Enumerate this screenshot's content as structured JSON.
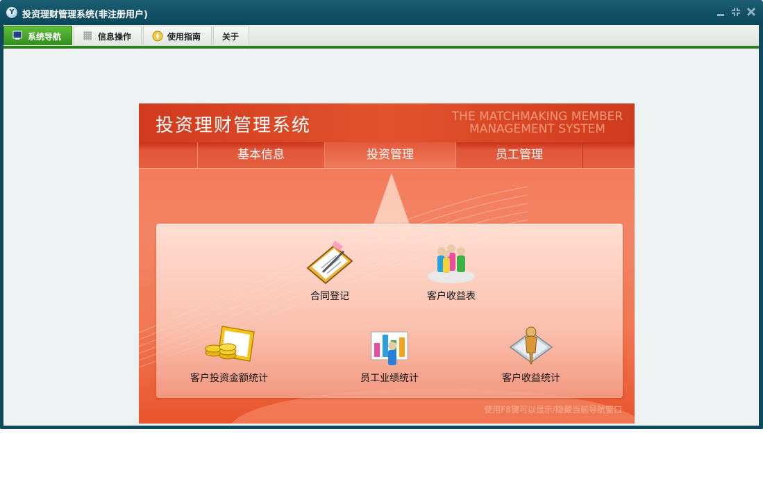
{
  "window": {
    "title": "投资理财管理系统(非注册用户)",
    "icon": "app-logo-icon",
    "app_icon_letter": "Y"
  },
  "toolbar": {
    "tabs": [
      {
        "label": "系统导航",
        "icon": "monitor-icon",
        "active": true
      },
      {
        "label": "信息操作",
        "icon": "grid-icon",
        "active": false
      },
      {
        "label": "使用指南",
        "icon": "compass-icon",
        "active": false
      },
      {
        "label": "关于",
        "icon": "",
        "active": false
      }
    ]
  },
  "panel": {
    "title": "投资理财管理系统",
    "english_title_line1": "THE MATCHMAKING MEMBER",
    "english_title_line2": "MANAGEMENT SYSTEM",
    "nav": [
      {
        "label": "基本信息",
        "active": false
      },
      {
        "label": "投资管理",
        "active": true
      },
      {
        "label": "员工管理",
        "active": false
      }
    ],
    "items": [
      {
        "label": "合同登记",
        "icon": "contract-icon"
      },
      {
        "label": "客户收益表",
        "icon": "customer-group-icon"
      },
      {
        "label": "客户投资金额统计",
        "icon": "coins-icon"
      },
      {
        "label": "员工业绩统计",
        "icon": "chart-people-icon"
      },
      {
        "label": "客户收益统计",
        "icon": "person-document-icon"
      }
    ],
    "hint": "使用F8键可以显示/隐藏当前导航窗口"
  },
  "colors": {
    "accent_green": "#2e7d1f",
    "titlebar": "#0d4a5e",
    "panel_red": "#e2532d"
  }
}
